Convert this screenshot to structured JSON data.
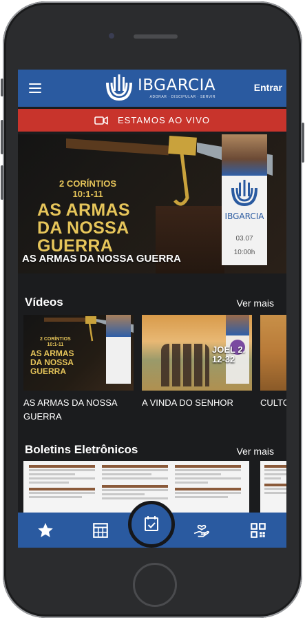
{
  "header": {
    "logo_name": "IBGARCIA",
    "logo_tagline": "ADORAR · DISCIPULAR · SERVIR",
    "login_label": "Entrar"
  },
  "live": {
    "label": "ESTAMOS AO VIVO"
  },
  "hero": {
    "reference_line1": "2 CORÍNTIOS",
    "reference_line2": "10:1-11",
    "big_line1": "AS ARMAS",
    "big_line2": "DA NOSSA",
    "big_line3": "GUERRA",
    "title": "AS ARMAS DA NOSSA GUERRA",
    "card_name": "IBGARCIA",
    "card_date": "03.07",
    "card_time": "10:00h"
  },
  "videos": {
    "section_title": "Vídeos",
    "see_more": "Ver mais",
    "items": [
      {
        "label": "AS ARMAS DA NOSSA GUERRA",
        "thumb_ref1": "2 CORÍNTIOS",
        "thumb_ref2": "10:1-11",
        "thumb_big1": "AS ARMAS",
        "thumb_big2": "DA NOSSA",
        "thumb_big3": "GUERRA"
      },
      {
        "label": "A VINDA DO SENHOR",
        "thumb_text1": "JOEL 2.",
        "thumb_text2": "12-32"
      },
      {
        "label": "CULTO"
      }
    ]
  },
  "bulletins": {
    "section_title": "Boletins Eletrônicos",
    "see_more": "Ver mais"
  },
  "bottom_nav": {
    "items": [
      "star-icon",
      "calendar-grid-icon",
      "calendar-check-icon",
      "hand-heart-icon",
      "qr-code-icon"
    ]
  },
  "colors": {
    "brand_blue": "#2a5aa0",
    "live_red": "#c8342c",
    "screen_bg": "#1b1c1e",
    "hero_gold": "#e6c55a"
  }
}
